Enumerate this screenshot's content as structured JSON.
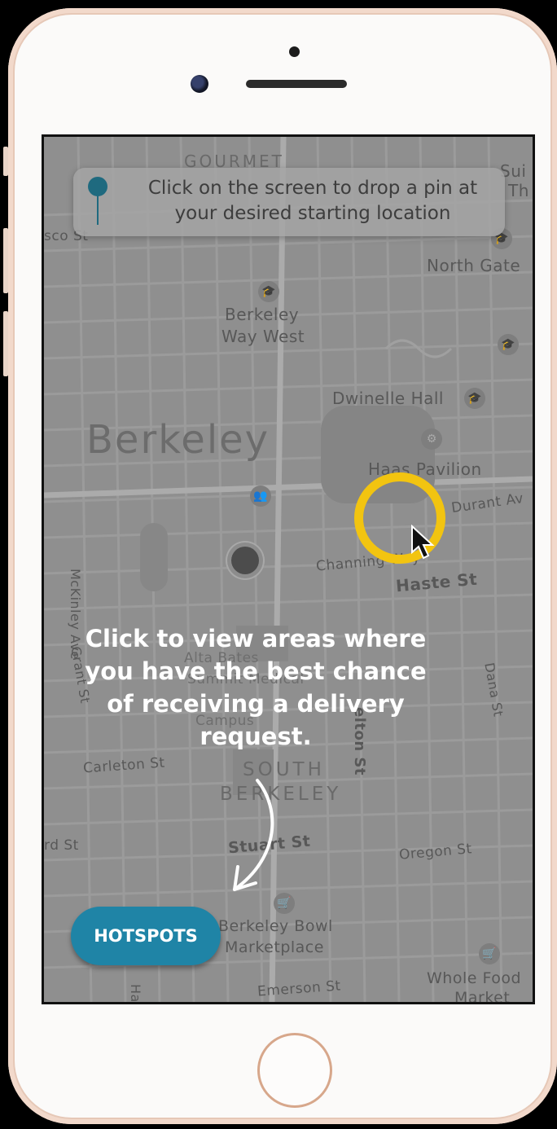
{
  "map": {
    "city_label": "Berkeley",
    "district_label_line1": "SOUTH",
    "district_label_line2": "BERKELEY",
    "partial_top_label": "GOURMET",
    "places": {
      "berkeley_way_west_line1": "Berkeley",
      "berkeley_way_west_line2": "Way West",
      "north_gate": "North Gate",
      "dwinelle_hall": "Dwinelle Hall",
      "haas_pavilion": "Haas Pavilion",
      "alta_bates_line1": "Alta Bates",
      "alta_bates_line2": "Summit Medical",
      "alta_bates_line3": "Campus",
      "berkeley_bowl_line1": "Berkeley Bowl",
      "berkeley_bowl_line2": "Marketplace",
      "whole_foods_line1": "Whole Food",
      "whole_foods_line2": "Market",
      "suite_partial_line1": "Sui",
      "suite_partial_line2": "Th"
    },
    "streets": {
      "haste": "Haste St",
      "channing": "Channing Way",
      "durant": "Durant Av",
      "telegraph_partial": "elton St",
      "mckinley": "McKinley Ave",
      "grant": "Grant St",
      "dana": "Dana St",
      "carleton": "Carleton St",
      "stuart": "Stuart St",
      "oregon": "Oregon St",
      "ward_partial": "rd St",
      "emerson": "Emerson St",
      "francisco_partial": "sco St",
      "ha_partial": "Ha"
    }
  },
  "tooltip": {
    "text": "Click on the screen to drop a pin at your desired starting location"
  },
  "guide": {
    "text": "Click to view areas where you have the best chance of receiving a delivery request."
  },
  "hotspots_button": {
    "label": "HOTSPOTS"
  },
  "colors": {
    "pin": "#1f6a7f",
    "hotspots_button": "#1f84a6",
    "cursor_highlight": "#f2c410",
    "map_dimmed": "#959595"
  }
}
